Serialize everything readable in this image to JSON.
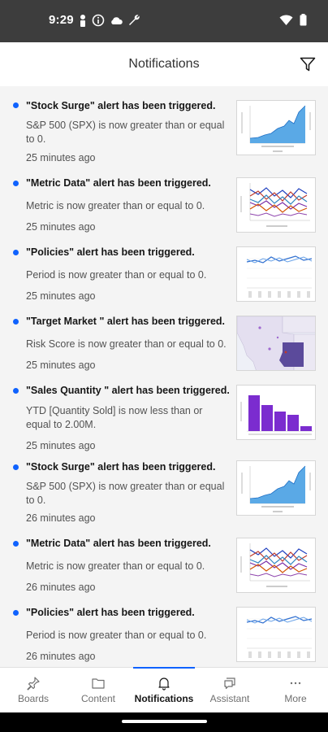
{
  "status_bar": {
    "time": "9:29"
  },
  "header": {
    "title": "Notifications"
  },
  "notifications": [
    {
      "title": "\"Stock Surge\" alert has been triggered.",
      "body": "S&P 500 (SPX) is now greater than or equal to 0.",
      "time": "25 minutes ago",
      "thumbnail": "area-chart"
    },
    {
      "title": "\"Metric Data\" alert has been triggered.",
      "body": "Metric is now greater than or equal to 0.",
      "time": "25 minutes ago",
      "thumbnail": "multi-line-chart"
    },
    {
      "title": "\"Policies\" alert has been triggered.",
      "body": "Period is now greater than or equal to 0.",
      "time": "25 minutes ago",
      "thumbnail": "line-chart"
    },
    {
      "title": "\"Target Market \" alert has been triggered.",
      "body": "Risk Score is now greater than or equal to 0.",
      "time": "25 minutes ago",
      "thumbnail": "map"
    },
    {
      "title": "\"Sales Quantity \" alert has been triggered.",
      "body": "YTD [Quantity Sold] is now less than or equal to 2.00M.",
      "time": "25 minutes ago",
      "thumbnail": "bar-chart"
    },
    {
      "title": "\"Stock Surge\" alert has been triggered.",
      "body": "S&P 500 (SPX) is now greater than or equal to 0.",
      "time": "26 minutes ago",
      "thumbnail": "area-chart"
    },
    {
      "title": "\"Metric Data\" alert has been triggered.",
      "body": "Metric is now greater than or equal to 0.",
      "time": "26 minutes ago",
      "thumbnail": "multi-line-chart"
    },
    {
      "title": "\"Policies\" alert has been triggered.",
      "body": "Period is now greater than or equal to 0.",
      "time": "26 minutes ago",
      "thumbnail": "line-chart"
    }
  ],
  "tabs": [
    {
      "label": "Boards",
      "icon": "pin-icon"
    },
    {
      "label": "Content",
      "icon": "folder-icon"
    },
    {
      "label": "Notifications",
      "icon": "bell-icon",
      "active": true
    },
    {
      "label": "Assistant",
      "icon": "chat-icon"
    },
    {
      "label": "More",
      "icon": "more-icon"
    }
  ],
  "colors": {
    "accent": "#0f62fe",
    "status_bar": "#3d3d3d",
    "list_bg": "#f4f4f4"
  }
}
